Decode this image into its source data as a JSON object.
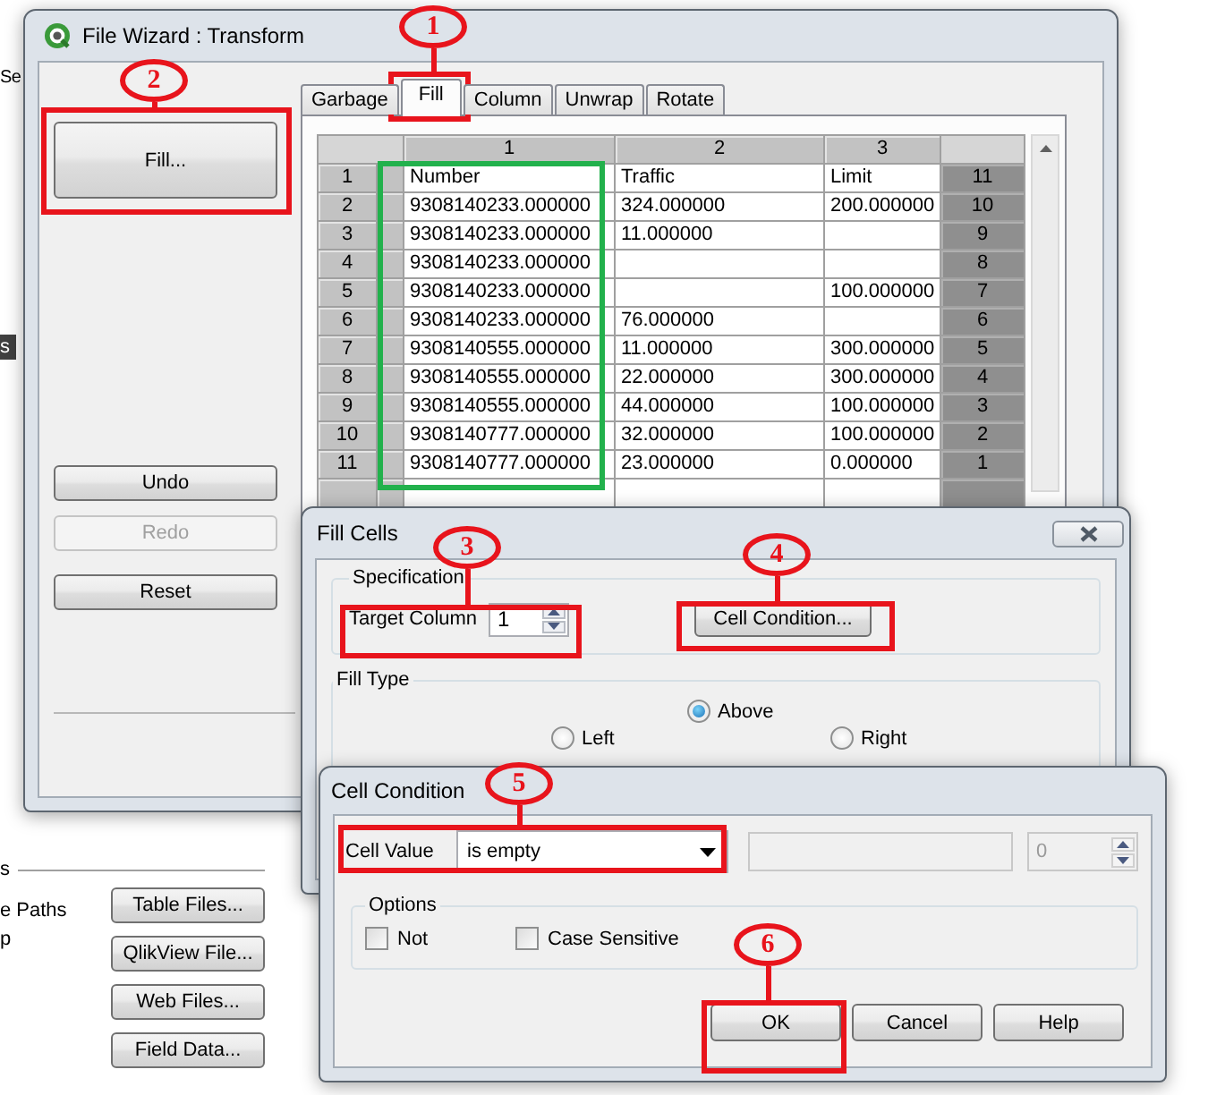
{
  "background": {
    "cut_texts": [
      "Se",
      "e Paths",
      "p"
    ],
    "side_tab": "s",
    "section_label": "s",
    "buttons": [
      "Table Files...",
      "QlikView File...",
      "Web Files...",
      "Field Data..."
    ]
  },
  "file_wizard": {
    "title": "File Wizard : Transform",
    "left_buttons": [
      {
        "label": "Fill...",
        "disabled": false
      },
      {
        "label": "Undo",
        "disabled": false
      },
      {
        "label": "Redo",
        "disabled": true
      },
      {
        "label": "Reset",
        "disabled": false
      }
    ],
    "tabs": [
      {
        "label": "Garbage",
        "selected": false
      },
      {
        "label": "Fill",
        "selected": true
      },
      {
        "label": "Column",
        "selected": false
      },
      {
        "label": "Unwrap",
        "selected": false
      },
      {
        "label": "Rotate",
        "selected": false
      }
    ],
    "table": {
      "columns": [
        "1",
        "2",
        "3"
      ],
      "rows": [
        {
          "row_number": "1",
          "cells": [
            "Number",
            "Traffic",
            "Limit"
          ],
          "trailing_number": "11"
        },
        {
          "row_number": "2",
          "cells": [
            "9308140233.000000",
            "324.000000",
            "200.000000"
          ],
          "trailing_number": "10"
        },
        {
          "row_number": "3",
          "cells": [
            "9308140233.000000",
            "11.000000",
            null
          ],
          "trailing_number": "9"
        },
        {
          "row_number": "4",
          "cells": [
            "9308140233.000000",
            null,
            null
          ],
          "trailing_number": "8"
        },
        {
          "row_number": "5",
          "cells": [
            "9308140233.000000",
            null,
            "100.000000"
          ],
          "trailing_number": "7"
        },
        {
          "row_number": "6",
          "cells": [
            "9308140233.000000",
            "76.000000",
            null
          ],
          "trailing_number": "6"
        },
        {
          "row_number": "7",
          "cells": [
            "9308140555.000000",
            "11.000000",
            "300.000000"
          ],
          "trailing_number": "5"
        },
        {
          "row_number": "8",
          "cells": [
            "9308140555.000000",
            "22.000000",
            "300.000000"
          ],
          "trailing_number": "4"
        },
        {
          "row_number": "9",
          "cells": [
            "9308140555.000000",
            "44.000000",
            "100.000000"
          ],
          "trailing_number": "3"
        },
        {
          "row_number": "10",
          "cells": [
            "9308140777.000000",
            "32.000000",
            "100.000000"
          ],
          "trailing_number": "2"
        },
        {
          "row_number": "11",
          "cells": [
            "9308140777.000000",
            "23.000000",
            "0.000000"
          ],
          "trailing_number": "1"
        }
      ]
    }
  },
  "fill_cells": {
    "title": "Fill Cells",
    "specification": {
      "title": "Specification",
      "target_label": "Target Column",
      "target_value": "1",
      "condition_button": "Cell Condition..."
    },
    "fill_type": {
      "title": "Fill Type",
      "options": [
        {
          "label": "Above",
          "selected": true
        },
        {
          "label": "Left",
          "selected": false
        },
        {
          "label": "Right",
          "selected": false
        }
      ]
    }
  },
  "cell_condition": {
    "title": "Cell Condition",
    "cell_value_label": "Cell Value",
    "operator": "is empty",
    "count_value": "0",
    "options_title": "Options",
    "options": [
      {
        "label": "Not",
        "checked": false
      },
      {
        "label": "Case Sensitive",
        "checked": false
      }
    ],
    "buttons": [
      "OK",
      "Cancel",
      "Help"
    ]
  },
  "annotations": [
    {
      "label": "1"
    },
    {
      "label": "2"
    },
    {
      "label": "3"
    },
    {
      "label": "4"
    },
    {
      "label": "5"
    },
    {
      "label": "6"
    }
  ]
}
